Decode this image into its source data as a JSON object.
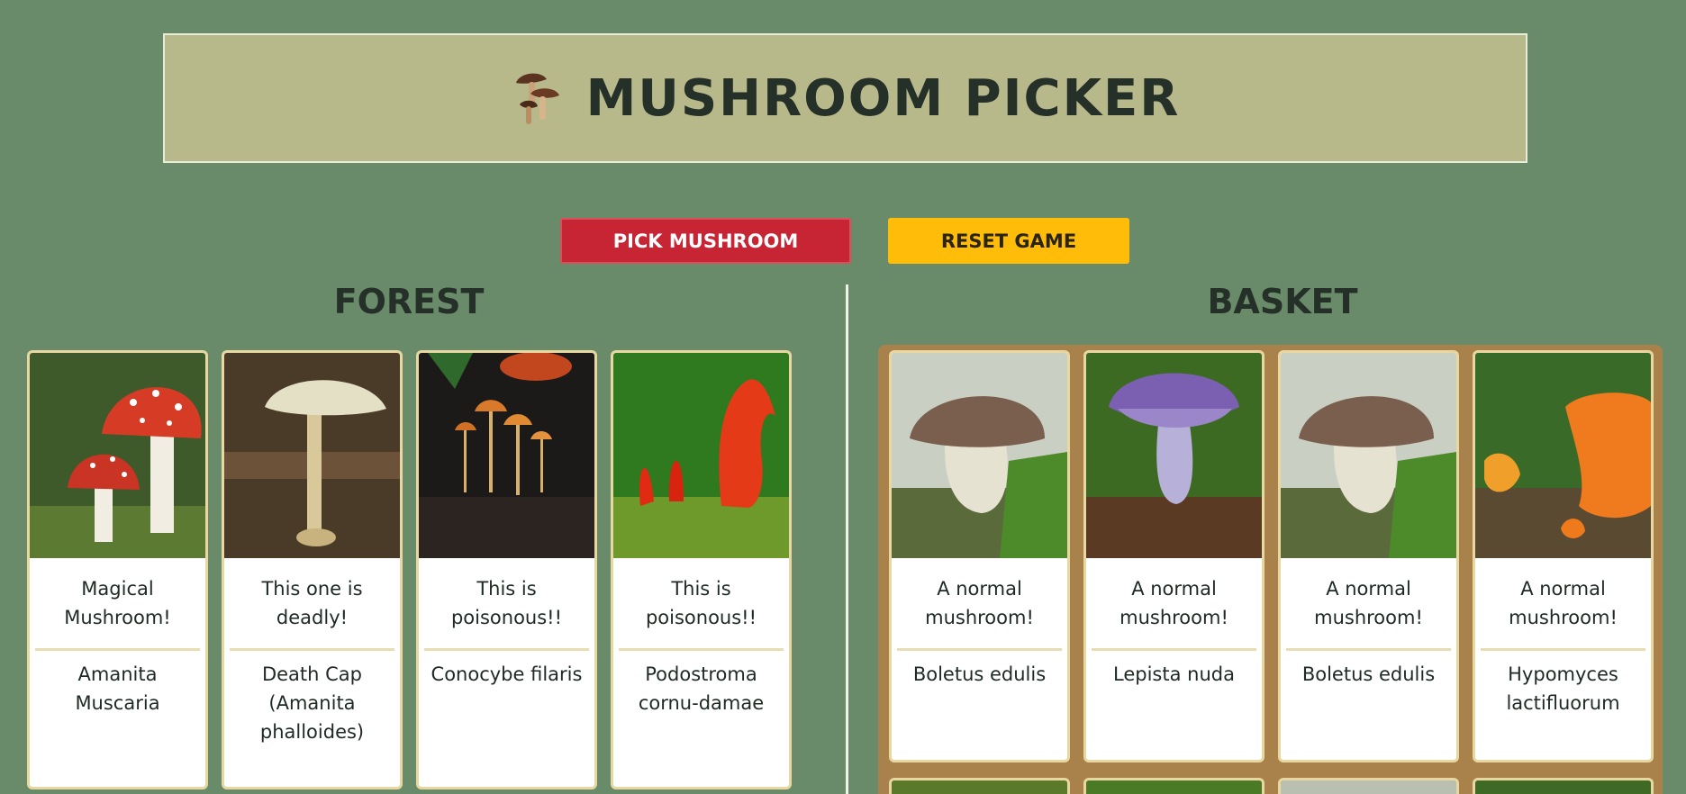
{
  "header": {
    "title": "MUSHROOM PICKER",
    "logo_icon": "mushroom-cluster-icon"
  },
  "buttons": {
    "pick_label": "PICK MUSHROOM",
    "reset_label": "RESET GAME"
  },
  "colors": {
    "background": "#6a8b6a",
    "banner": "#b8b98b",
    "pick": "#c72533",
    "reset": "#ffbd0a",
    "basket": "#a9824b",
    "card_border": "#e8d7a0"
  },
  "forest": {
    "title": "FOREST",
    "cards": [
      {
        "description": "Magical Mushroom!",
        "name": "Amanita Muscaria",
        "image": "fly-agaric-photo"
      },
      {
        "description": "This one is deadly!",
        "name": "Death Cap (Amanita phalloides)",
        "image": "death-cap-photo"
      },
      {
        "description": "This is poisonous!!",
        "name": "Conocybe filaris",
        "image": "conocybe-photo"
      },
      {
        "description": "This is poisonous!!",
        "name": "Podostroma cornu-damae",
        "image": "poison-fire-coral-photo"
      }
    ]
  },
  "basket": {
    "title": "BASKET",
    "cards": [
      {
        "description": "A normal mushroom!",
        "name": "Boletus edulis",
        "image": "porcini-photo"
      },
      {
        "description": "A normal mushroom!",
        "name": "Lepista nuda",
        "image": "wood-blewit-photo"
      },
      {
        "description": "A normal mushroom!",
        "name": "Boletus edulis",
        "image": "porcini-photo"
      },
      {
        "description": "A normal mushroom!",
        "name": "Hypomyces lactifluorum",
        "image": "lobster-mushroom-photo"
      }
    ]
  }
}
